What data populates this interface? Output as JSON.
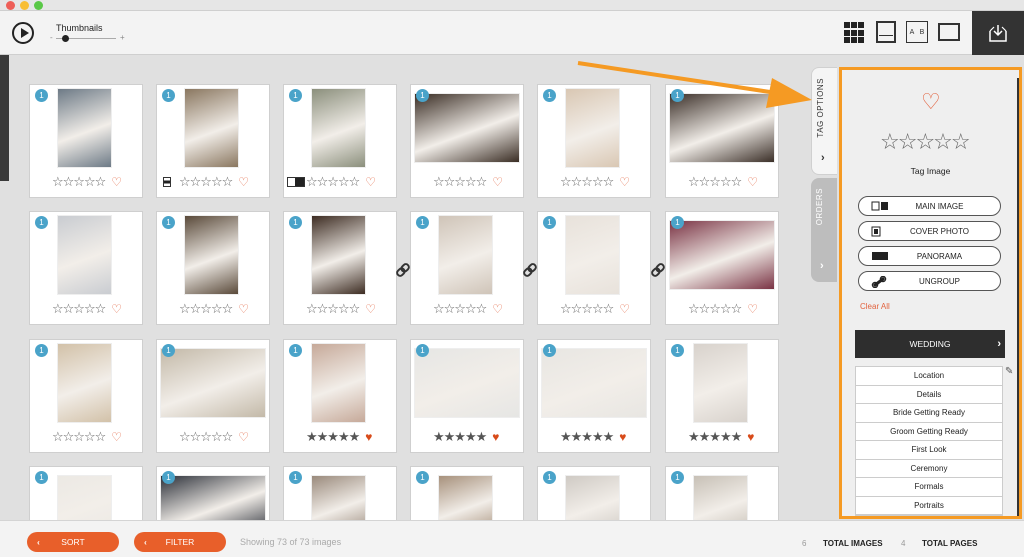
{
  "window": {
    "traffic_colors": [
      "#ee5f58",
      "#f8be35",
      "#5ac847"
    ]
  },
  "toolbar": {
    "thumbnails_label": "Thumbnails",
    "slider_minus": "-",
    "slider_plus": "+",
    "ab_left": "A",
    "ab_right": "B"
  },
  "thumbnails": [
    {
      "badge": "1",
      "rating": "☆☆☆☆☆",
      "heart": "♡",
      "filled": false
    },
    {
      "badge": "1",
      "rating": "☆☆☆☆☆",
      "heart": "♡",
      "filled": false
    },
    {
      "badge": "1",
      "rating": "☆☆☆☆☆",
      "heart": "♡",
      "filled": false
    },
    {
      "badge": "1",
      "rating": "☆☆☆☆☆",
      "heart": "♡",
      "filled": false
    },
    {
      "badge": "1",
      "rating": "☆☆☆☆☆",
      "heart": "♡",
      "filled": false
    },
    {
      "badge": "1",
      "rating": "☆☆☆☆☆",
      "heart": "♡",
      "filled": false
    },
    {
      "badge": "1",
      "rating": "☆☆☆☆☆",
      "heart": "♡",
      "filled": false
    },
    {
      "badge": "1",
      "rating": "☆☆☆☆☆",
      "heart": "♡",
      "filled": false
    },
    {
      "badge": "1",
      "rating": "☆☆☆☆☆",
      "heart": "♡",
      "filled": false
    },
    {
      "badge": "1",
      "rating": "☆☆☆☆☆",
      "heart": "♡",
      "filled": false
    },
    {
      "badge": "1",
      "rating": "☆☆☆☆☆",
      "heart": "♡",
      "filled": false
    },
    {
      "badge": "1",
      "rating": "☆☆☆☆☆",
      "heart": "♡",
      "filled": false
    },
    {
      "badge": "1",
      "rating": "☆☆☆☆☆",
      "heart": "♡",
      "filled": false
    },
    {
      "badge": "1",
      "rating": "☆☆☆☆☆",
      "heart": "♡",
      "filled": false
    },
    {
      "badge": "1",
      "rating": "★★★★★",
      "heart": "♥",
      "filled": true
    },
    {
      "badge": "1",
      "rating": "★★★★★",
      "heart": "♥",
      "filled": true
    },
    {
      "badge": "1",
      "rating": "★★★★★",
      "heart": "♥",
      "filled": true
    },
    {
      "badge": "1",
      "rating": "★★★★★",
      "heart": "♥",
      "filled": true
    },
    {
      "badge": "1",
      "rating": "",
      "heart": "",
      "filled": false
    },
    {
      "badge": "1",
      "rating": "",
      "heart": "",
      "filled": false
    },
    {
      "badge": "1",
      "rating": "",
      "heart": "",
      "filled": false
    },
    {
      "badge": "1",
      "rating": "",
      "heart": "",
      "filled": false
    },
    {
      "badge": "1",
      "rating": "",
      "heart": "",
      "filled": false
    },
    {
      "badge": "1",
      "rating": "",
      "heart": "",
      "filled": false
    }
  ],
  "photo_colors": [
    "#6d7a86",
    "#8a7760",
    "#8b8f7c",
    "#3a2d24",
    "#d9c7b3",
    "#3b2f28",
    "#c9ccd1",
    "#5a4a3a",
    "#3d2c22",
    "#cfc4b8",
    "#e8e2db",
    "#7a3344",
    "#d2c1a8",
    "#c3b9a8",
    "#c6a999",
    "#e6e6e4",
    "#e8e6e2",
    "#d8d2cc",
    "#ece9e4",
    "#2c3039",
    "#9a8a7c",
    "#a7917c",
    "#cfcac4",
    "#c7c0b6"
  ],
  "tabs": {
    "tag_options": "TAG OPTIONS",
    "orders": "ORDERS",
    "chevron": "›"
  },
  "panel": {
    "heart": "♡",
    "stars": "☆☆☆☆☆",
    "tag_image": "Tag Image",
    "buttons": [
      {
        "label": "MAIN IMAGE"
      },
      {
        "label": "COVER PHOTO"
      },
      {
        "label": "PANORAMA"
      },
      {
        "label": "UNGROUP"
      }
    ],
    "clear_all": "Clear All",
    "category": "WEDDING",
    "category_chevron": "›",
    "subcategories": [
      "Location",
      "Details",
      "Bride Getting Ready",
      "Groom Getting Ready",
      "First Look",
      "Ceremony",
      "Formals",
      "Portraits"
    ],
    "pencil": "✎"
  },
  "bottom": {
    "sort": "SORT",
    "filter": "FILTER",
    "chevron": "‹",
    "showing": "Showing 73 of 73 images",
    "total_images_count": "6",
    "total_images_label": "TOTAL IMAGES",
    "total_pages_count": "4",
    "total_pages_label": "TOTAL PAGES"
  },
  "colors": {
    "accent_orange": "#f59a23",
    "sort_filter": "#e85f2a",
    "heart": "#e2633f",
    "badge": "#4aa3c9"
  }
}
